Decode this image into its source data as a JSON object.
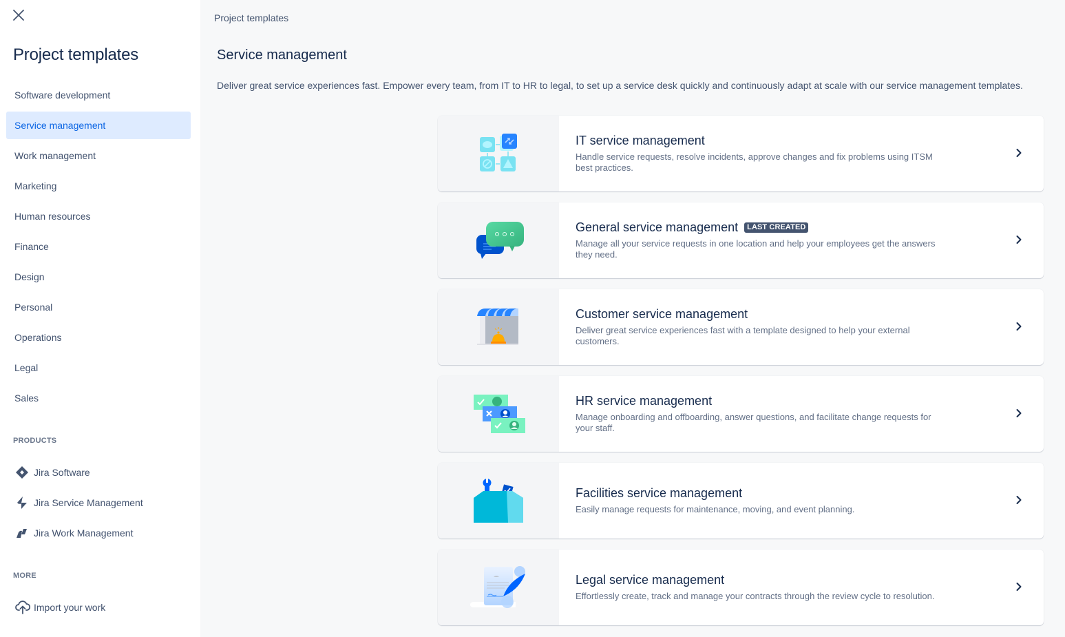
{
  "sidebar": {
    "close_icon": "close-icon",
    "title": "Project templates",
    "nav_items": [
      {
        "label": "Software development",
        "active": false
      },
      {
        "label": "Service management",
        "active": true
      },
      {
        "label": "Work management",
        "active": false
      },
      {
        "label": "Marketing",
        "active": false
      },
      {
        "label": "Human resources",
        "active": false
      },
      {
        "label": "Finance",
        "active": false
      },
      {
        "label": "Design",
        "active": false
      },
      {
        "label": "Personal",
        "active": false
      },
      {
        "label": "Operations",
        "active": false
      },
      {
        "label": "Legal",
        "active": false
      },
      {
        "label": "Sales",
        "active": false
      }
    ],
    "products_label": "PRODUCTS",
    "products": [
      {
        "label": "Jira Software",
        "icon": "jira-software-icon"
      },
      {
        "label": "Jira Service Management",
        "icon": "jira-service-management-icon"
      },
      {
        "label": "Jira Work Management",
        "icon": "jira-work-management-icon"
      }
    ],
    "more_label": "MORE",
    "more": [
      {
        "label": "Import your work",
        "icon": "cloud-upload-icon"
      }
    ]
  },
  "main": {
    "breadcrumb": "Project templates",
    "title": "Service management",
    "description": "Deliver great service experiences fast. Empower every team, from IT to HR to legal, to set up a service desk quickly and continuously adapt at scale with our service management templates.",
    "templates": [
      {
        "title": "IT service management",
        "badge": null,
        "description": "Handle service requests, resolve incidents, approve changes and fix problems using ITSM best practices.",
        "illustration": "it-service-illustration"
      },
      {
        "title": "General service management",
        "badge": "LAST CREATED",
        "description": "Manage all your service requests in one location and help your employees get the answers they need.",
        "illustration": "chat-bubbles-illustration"
      },
      {
        "title": "Customer service management",
        "badge": null,
        "description": "Deliver great service experiences fast with a template designed to help your external customers.",
        "illustration": "storefront-bell-illustration"
      },
      {
        "title": "HR service management",
        "badge": null,
        "description": "Manage onboarding and offboarding, answer questions, and facilitate change requests for your staff.",
        "illustration": "hr-cards-illustration"
      },
      {
        "title": "Facilities service management",
        "badge": null,
        "description": "Easily manage requests for maintenance, moving, and event planning.",
        "illustration": "toolbox-illustration"
      },
      {
        "title": "Legal service management",
        "badge": null,
        "description": "Effortlessly create, track and manage your contracts through the review cycle to resolution.",
        "illustration": "contract-quill-illustration"
      }
    ]
  },
  "colors": {
    "accent": "#0c66e4",
    "active_bg": "#deebff",
    "badge_bg": "#44546f",
    "text_primary": "#172b4d",
    "text_secondary": "#44546f"
  }
}
